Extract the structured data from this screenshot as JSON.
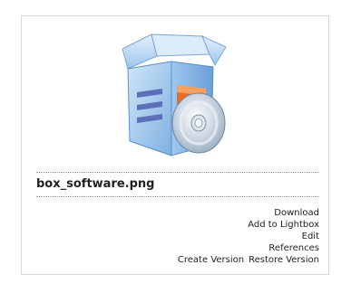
{
  "asset": {
    "filename": "box_software.png",
    "thumbnail_icon": "software-box-cd-icon"
  },
  "actions": {
    "download": "Download",
    "add_to_lightbox": "Add to Lightbox",
    "edit": "Edit",
    "references": "References",
    "create_version": "Create Version",
    "restore_version": "Restore Version"
  },
  "colors": {
    "box_blue": "#8fbde6",
    "box_dark_blue": "#5d8fcc",
    "cd_silver": "#c9d3dc",
    "accent_orange": "#f06a1f",
    "text": "#222222",
    "border": "#d9d9d9"
  }
}
